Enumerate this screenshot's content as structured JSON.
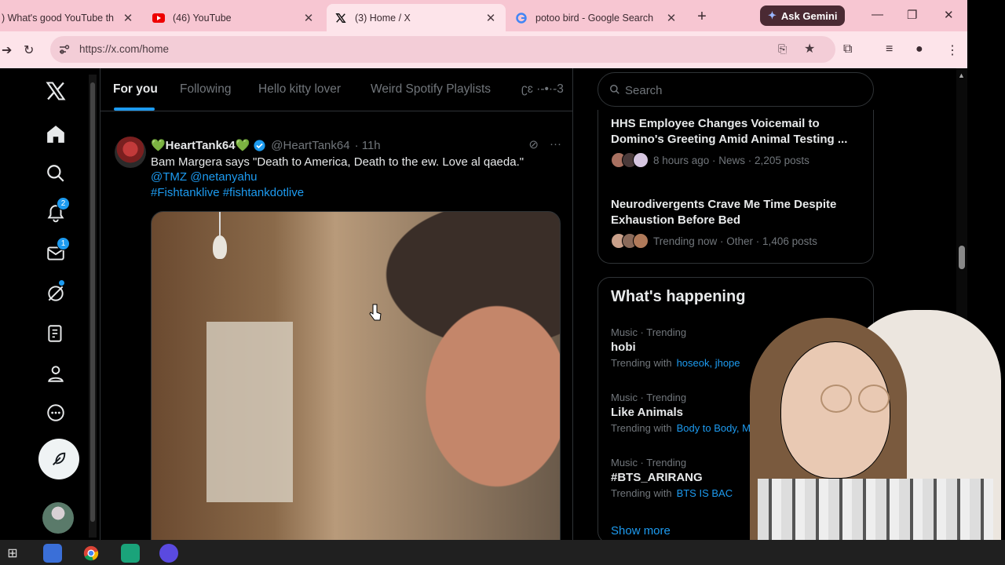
{
  "browser": {
    "tabs": [
      {
        "title": ") What's good YouTube th",
        "icon": "youtube-icon",
        "active": false
      },
      {
        "title": "(46) YouTube",
        "icon": "youtube-icon",
        "active": false
      },
      {
        "title": "(3) Home / X",
        "icon": "x-logo-icon",
        "active": true
      },
      {
        "title": "potoo bird - Google Search",
        "icon": "google-icon",
        "active": false
      }
    ],
    "gemini_label": "Ask Gemini",
    "url": "https://x.com/home"
  },
  "nav": {
    "notifications_badge": "2",
    "messages_badge": "1"
  },
  "feed": {
    "tabs": [
      "For you",
      "Following",
      "Hello kitty lover",
      "Weird Spotify Playlists"
    ],
    "tab_overflow": "ʗɛ ·-•·-3",
    "post": {
      "name": "💚HeartTank64💚",
      "handle": "@HeartTank64",
      "time": "· 11h",
      "text": "Bam Margera says \"Death to America, Death to the ew. Love al qaeda.\"",
      "mentions": "@TMZ @netanyahu",
      "hashtags": "#Fishtanklive #fishtankdotlive"
    }
  },
  "sidebar": {
    "search_placeholder": "Search",
    "news": [
      {
        "headline": "HHS Employee Changes Voicemail to Domino's Greeting Amid Animal Testing ...",
        "meta": "8 hours ago · News · 2,205 posts"
      },
      {
        "headline": "Neurodivergents Crave Me Time Despite Exhaustion Before Bed",
        "meta": "Trending now · Other · 1,406 posts"
      }
    ],
    "whats_happening_title": "What's happening",
    "trends": [
      {
        "category": "Music · Trending",
        "name": "hobi",
        "with_label": "Trending with",
        "with": "hoseok, jhope"
      },
      {
        "category": "Music · Trending",
        "name": "Like Animals",
        "with_label": "Trending with",
        "with": "Body to Body, M"
      },
      {
        "category": "Music · Trending",
        "name": "#BTS_ARIRANG",
        "with_label": "Trending with",
        "with": "BTS IS BAC"
      }
    ],
    "show_more": "Show more"
  },
  "colors": {
    "accent": "#1d9bf0",
    "tabstrip": "#f7c6d2",
    "text": "#e7e9ea",
    "muted": "#71767b"
  }
}
